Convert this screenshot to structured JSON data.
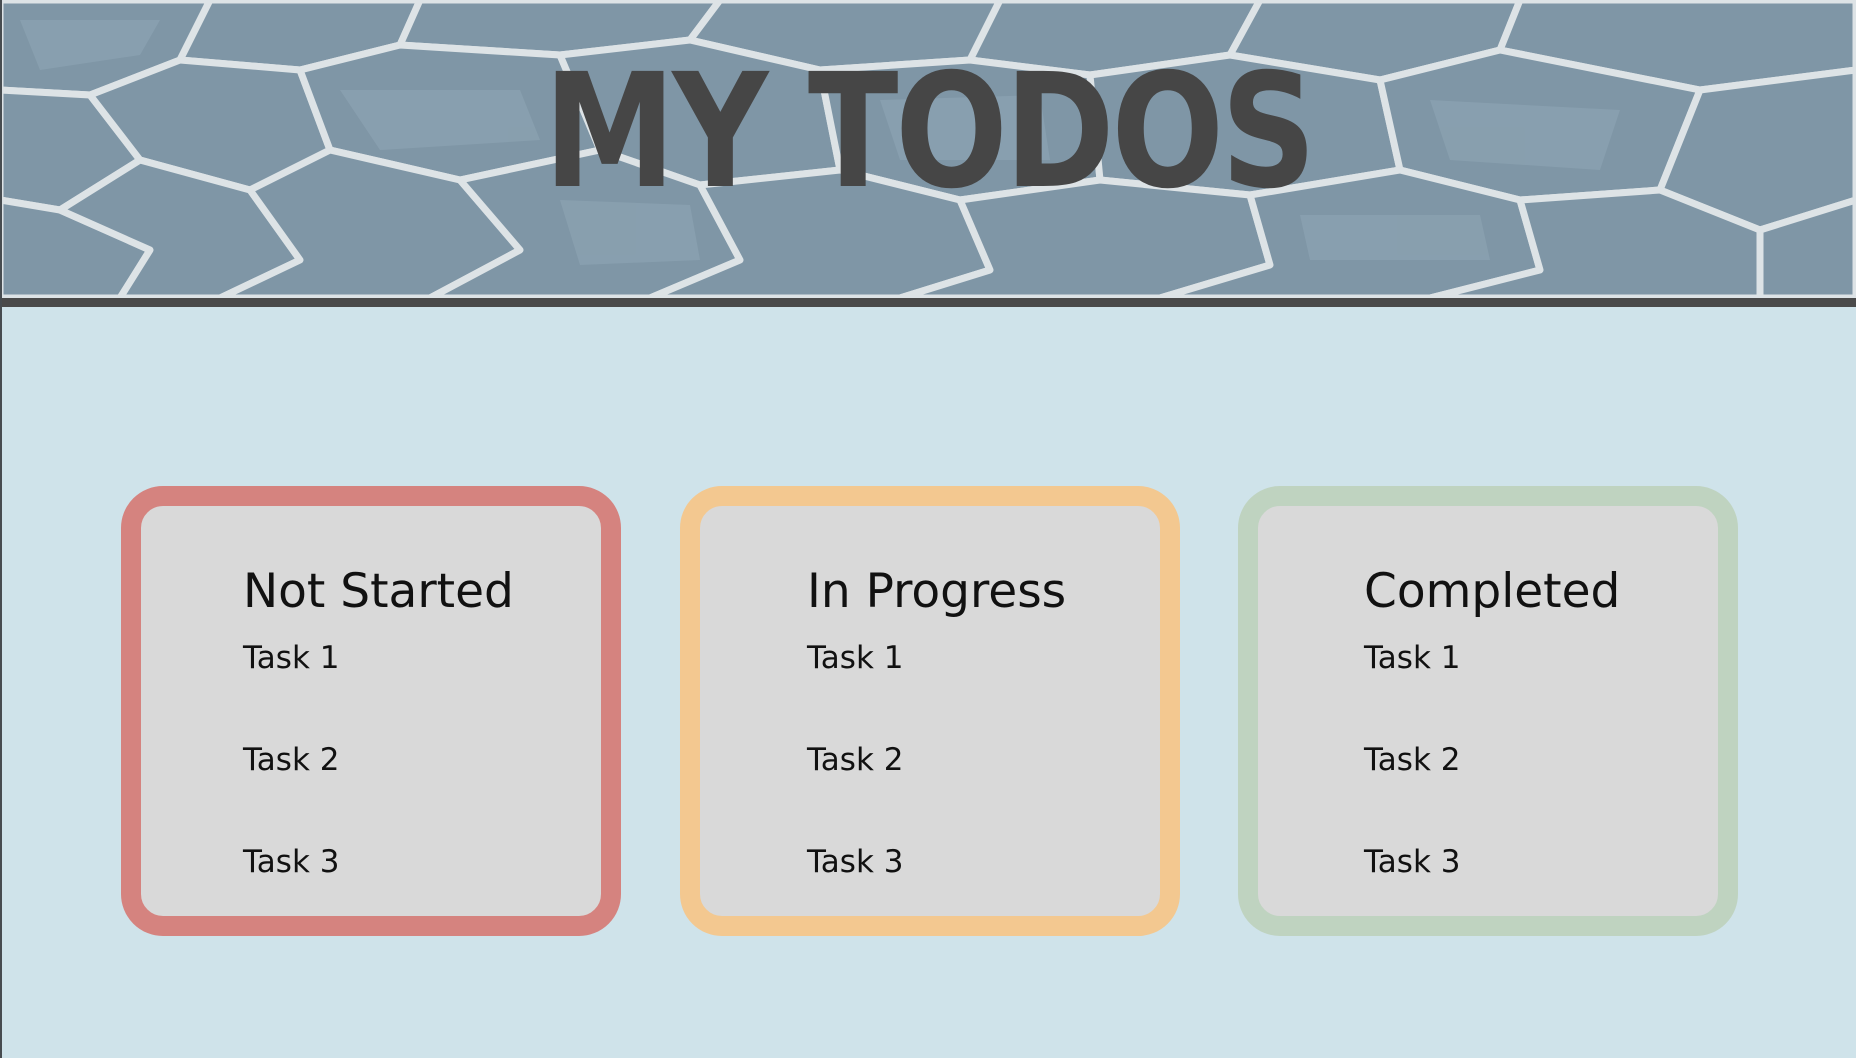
{
  "app": {
    "title": "MY TODOS"
  },
  "colors": {
    "page_background": "#cfe3ea",
    "title_text": "#464646",
    "header_rule": "#4a4a4a",
    "card_fill": "#d9d9d9"
  },
  "columns": [
    {
      "title": "Not Started",
      "border_color": "#d5837f",
      "tasks": [
        "Task 1",
        "Task 2",
        "Task 3"
      ]
    },
    {
      "title": "In Progress",
      "border_color": "#f3c890",
      "tasks": [
        "Task 1",
        "Task 2",
        "Task 3"
      ]
    },
    {
      "title": "Completed",
      "border_color": "#bfd3c0",
      "tasks": [
        "Task 1",
        "Task 2",
        "Task 3"
      ]
    }
  ]
}
